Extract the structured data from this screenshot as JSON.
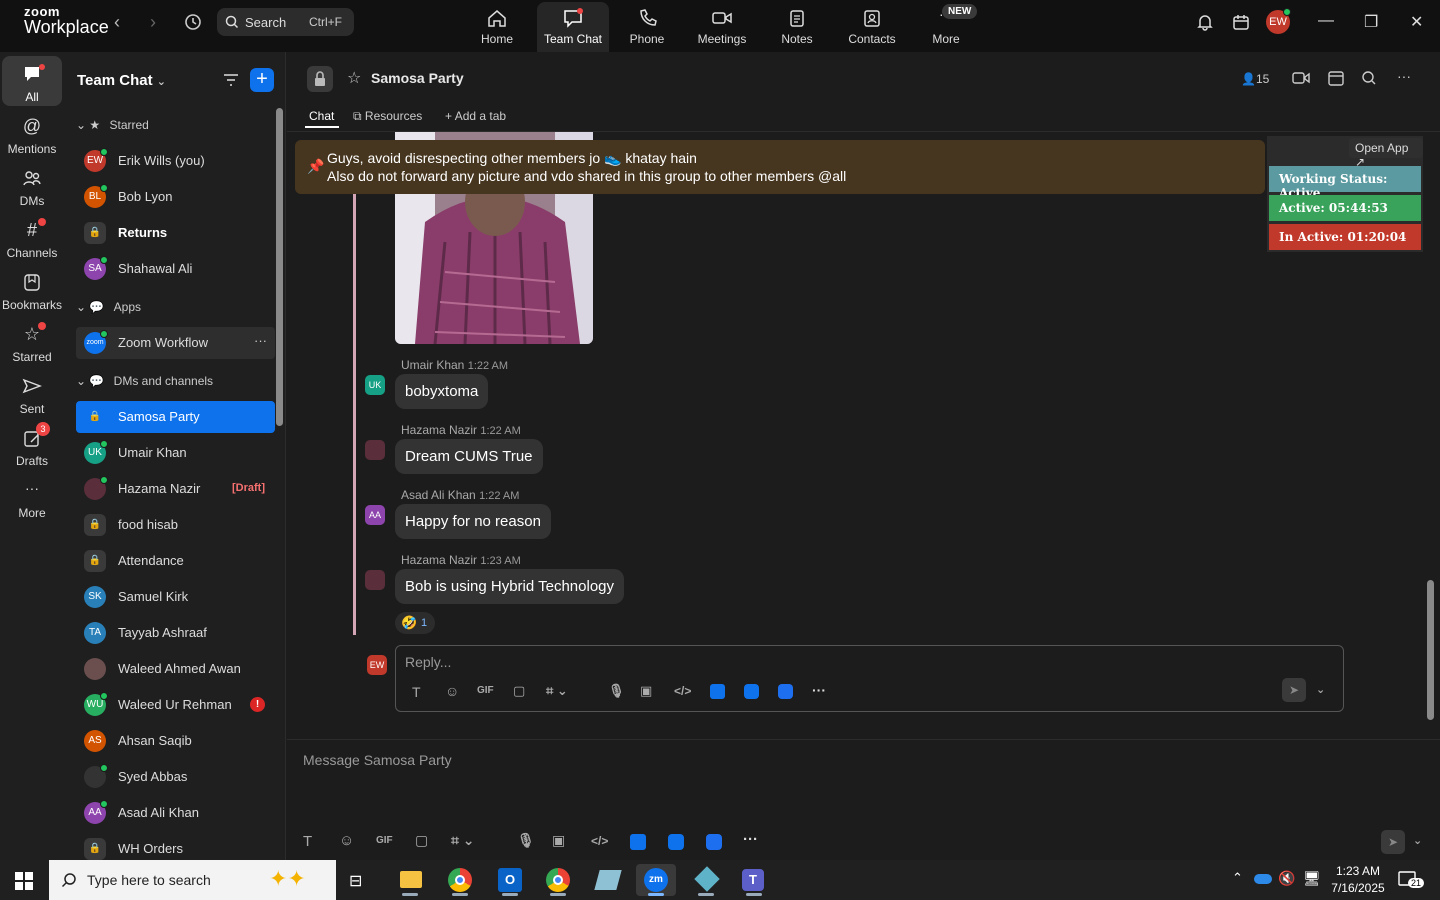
{
  "colors": {
    "accent": "#0e72ed",
    "pinned_bg": "#47361f",
    "working_status": "#5b9aa0",
    "active_status": "#3aa35b",
    "inactive_status": "#c0392b",
    "online": "#22c55e"
  },
  "topbar": {
    "logo_small": "zoom",
    "logo_big": "Workplace",
    "search_label": "Search",
    "search_shortcut": "Ctrl+F",
    "nav": [
      {
        "label": "Home",
        "icon": "home-icon"
      },
      {
        "label": "Team Chat",
        "icon": "chat-icon"
      },
      {
        "label": "Phone",
        "icon": "phone-icon"
      },
      {
        "label": "Meetings",
        "icon": "video-icon"
      },
      {
        "label": "Notes",
        "icon": "notes-icon"
      },
      {
        "label": "Contacts",
        "icon": "contacts-icon"
      },
      {
        "label": "More",
        "icon": "more-icon"
      }
    ],
    "new_badge": "NEW",
    "user_initials": "EW"
  },
  "rail": {
    "items": [
      {
        "label": "All"
      },
      {
        "label": "Mentions"
      },
      {
        "label": "DMs"
      },
      {
        "label": "Channels"
      },
      {
        "label": "Bookmarks"
      },
      {
        "label": "Starred"
      },
      {
        "label": "Sent"
      },
      {
        "label": "Drafts",
        "badge": "3"
      },
      {
        "label": "More"
      }
    ]
  },
  "sidebar": {
    "title": "Team Chat",
    "sections": {
      "starred": "Starred",
      "apps": "Apps",
      "dms": "DMs and channels"
    },
    "starred_items": [
      {
        "label": "Erik Wills (you)",
        "initials": "EW",
        "color": "#c0392b"
      },
      {
        "label": "Bob Lyon",
        "initials": "BL",
        "color": "#d35400"
      },
      {
        "label": "Returns",
        "initials": "",
        "color": "#3a3a3a"
      },
      {
        "label": "Shahawal Ali",
        "initials": "SA",
        "color": "#8e44ad"
      }
    ],
    "app_items": [
      {
        "label": "Zoom Workflow",
        "initials": "zoom"
      }
    ],
    "dm_items": [
      {
        "label": "Samosa Party",
        "initials": ""
      },
      {
        "label": "Umair Khan",
        "initials": "UK",
        "color": "#16a085"
      },
      {
        "label": "Hazama Nazir",
        "initials": "",
        "color": "#5a2e3a",
        "draft": "[Draft]"
      },
      {
        "label": "food hisab",
        "initials": ""
      },
      {
        "label": "Attendance",
        "initials": ""
      },
      {
        "label": "Samuel Kirk",
        "initials": "SK",
        "color": "#2980b9"
      },
      {
        "label": "Tayyab Ashraaf",
        "initials": "TA",
        "color": "#2980b9"
      },
      {
        "label": "Waleed Ahmed Awan",
        "initials": "",
        "color": "#6b4f4f"
      },
      {
        "label": "Waleed Ur Rehman",
        "initials": "WU",
        "color": "#27ae60",
        "alert": "!"
      },
      {
        "label": "Ahsan Saqib",
        "initials": "AS",
        "color": "#d35400"
      },
      {
        "label": "Syed Abbas",
        "initials": "",
        "color": "#333"
      },
      {
        "label": "Asad Ali Khan",
        "initials": "AA",
        "color": "#8e44ad"
      },
      {
        "label": "WH Orders",
        "initials": ""
      }
    ]
  },
  "channel": {
    "title": "Samosa Party",
    "member_count": "15",
    "tabs": [
      "Chat",
      "Resources",
      "Add a tab"
    ],
    "pinned_line1": "Guys, avoid disrespecting other members jo 👟 khatay hain",
    "pinned_line2": "Also do not forward any picture and vdo shared in this group to other members @all",
    "messages": [
      {
        "author": "Umair Khan",
        "time": "1:22 AM",
        "text": "bobyxtoma",
        "initials": "UK",
        "color": "#16a085"
      },
      {
        "author": "Hazama Nazir",
        "time": "1:22 AM",
        "text": "Dream CUMS True",
        "initials": "",
        "color": "#5a2e3a"
      },
      {
        "author": "Asad Ali Khan",
        "time": "1:22 AM",
        "text": "Happy for no reason",
        "initials": "AA",
        "color": "#8e44ad"
      },
      {
        "author": "Hazama Nazir",
        "time": "1:23 AM",
        "text": "Bob is using Hybrid Technology",
        "initials": "",
        "color": "#5a2e3a"
      }
    ],
    "reaction": {
      "emoji": "🤣",
      "count": "1"
    },
    "reply_placeholder": "Reply...",
    "reply_user": "EW",
    "composer_placeholder": "Message Samosa Party",
    "gif_label": "GIF"
  },
  "app_panel": {
    "open_app": "Open App ↗",
    "working_status": "Working Status: Active",
    "active": "Active: 05:44:53",
    "inactive": "In Active: 01:20:04"
  },
  "taskbar": {
    "search_placeholder": "Type here to search",
    "time": "1:23 AM",
    "date": "7/16/2025",
    "notifications": "21"
  }
}
